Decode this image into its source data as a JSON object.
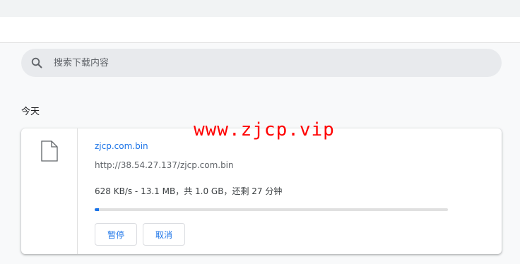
{
  "search": {
    "placeholder": "搜索下载内容",
    "icon": "search-icon"
  },
  "sections": [
    {
      "title": "今天",
      "downloads": [
        {
          "file_icon": "file-icon",
          "file_name": "zjcp.com.bin",
          "url": "http://38.54.27.137/zjcp.com.bin",
          "status": "628 KB/s - 13.1 MB，共 1.0 GB，还剩 27 分钟",
          "progress_fraction": 0.0128,
          "buttons": {
            "pause": "暂停",
            "cancel": "取消"
          }
        }
      ]
    }
  ],
  "watermark": "www.zjcp.vip",
  "colors": {
    "accent": "#1a73e8",
    "watermark": "#ff0000",
    "search_bg": "#e8eaed",
    "page_bg": "#f8f9fa"
  }
}
